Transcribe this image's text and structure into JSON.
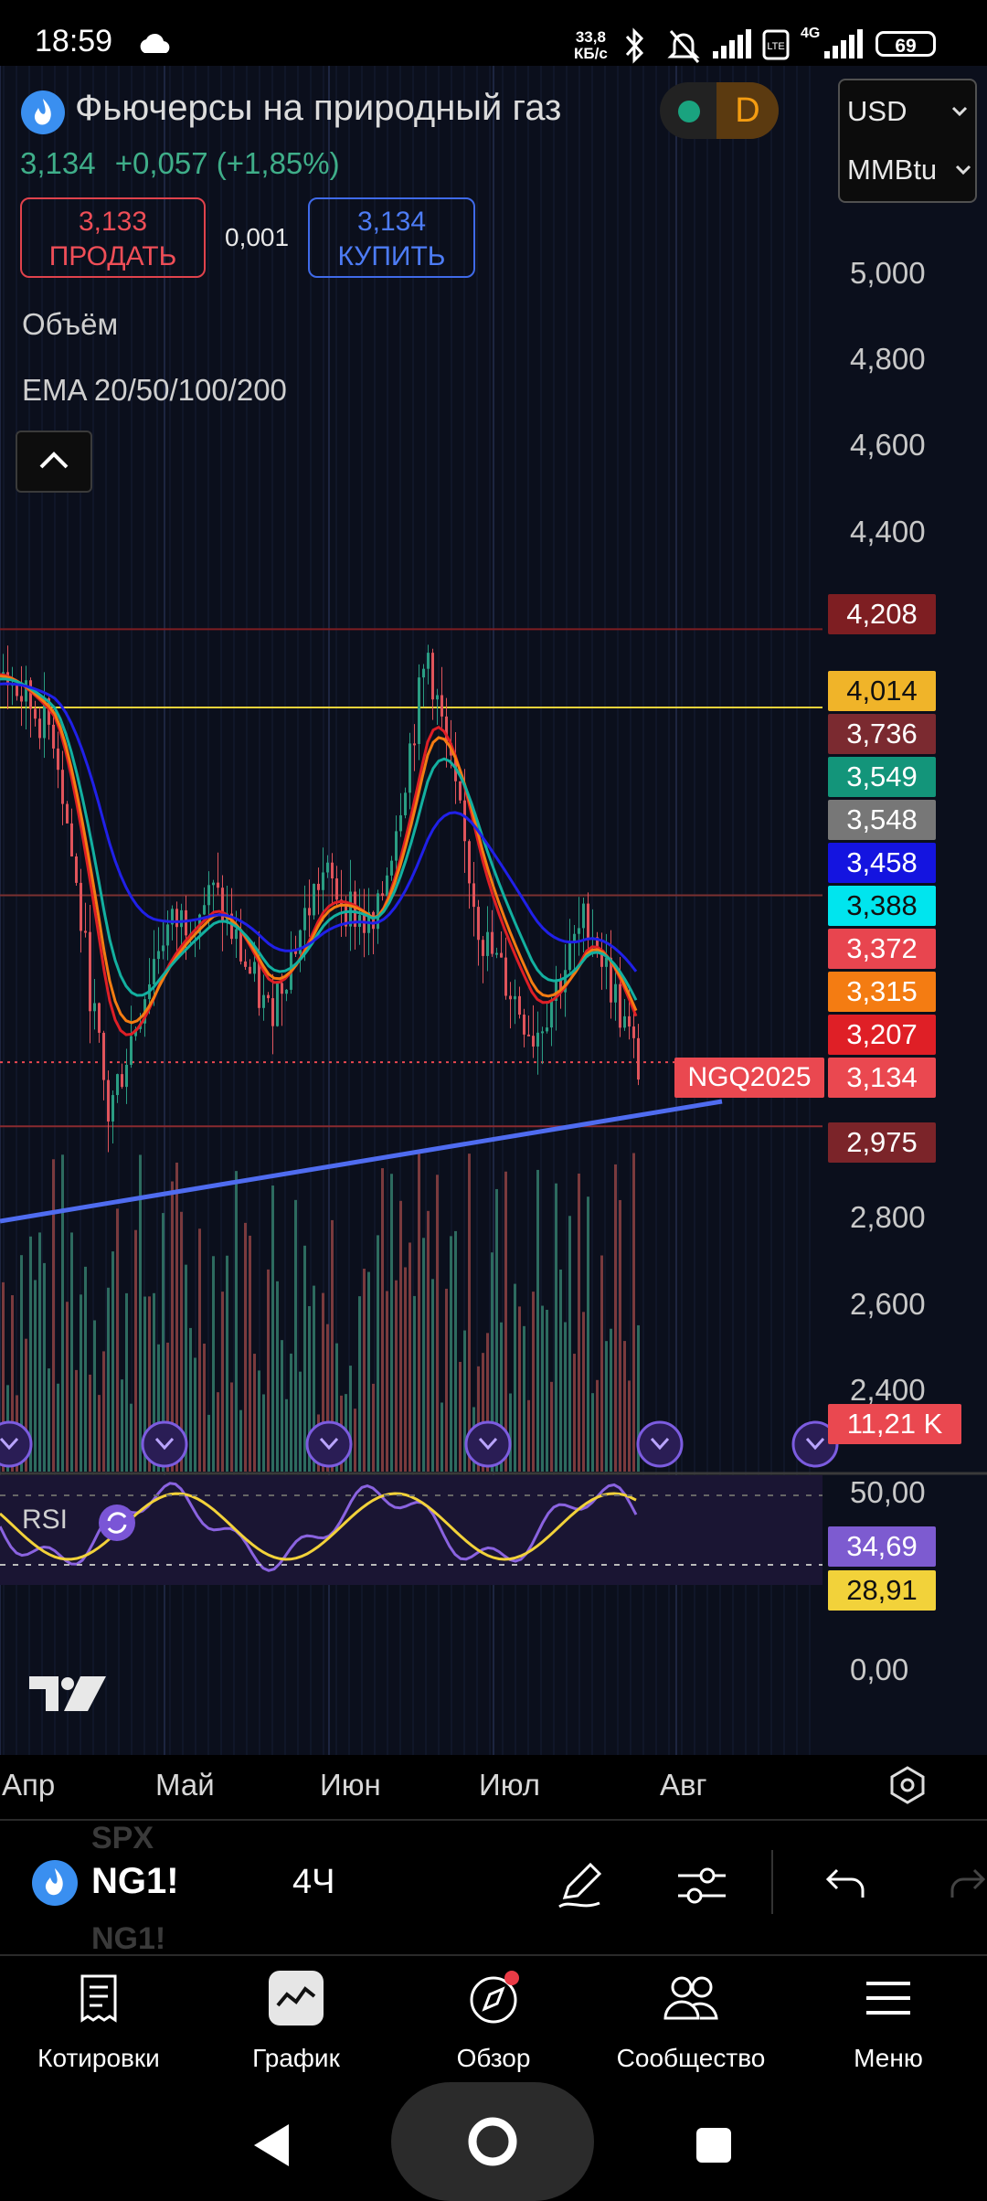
{
  "status_bar": {
    "time": "18:59",
    "net_speed_value": "33,8",
    "net_speed_unit": "КБ/с",
    "network": "4G",
    "battery": "69"
  },
  "header": {
    "title": "Фьючерсы на природный газ",
    "badge": "D",
    "last_price": "3,134",
    "change": "+0,057",
    "change_pct": "(+1,85%)",
    "currency": "USD",
    "unit": "MMBtu"
  },
  "trade": {
    "sell_price": "3,133",
    "sell_label": "ПРОДАТЬ",
    "spread": "0,001",
    "buy_price": "3,134",
    "buy_label": "КУПИТЬ"
  },
  "indicators": {
    "volume": "Объём",
    "ema": "EMA 20/50/100/200",
    "rsi": "RSI"
  },
  "price_axis": {
    "labels": [
      "5,000",
      "4,800",
      "4,600",
      "4,400",
      "2,800",
      "2,600",
      "2,400",
      "50,00",
      "0,00"
    ],
    "badges": [
      {
        "text": "4,208",
        "color": "#7e1e22"
      },
      {
        "text": "4,014",
        "color": "#f0b429"
      },
      {
        "text": "3,736",
        "color": "#7b2a30"
      },
      {
        "text": "3,549",
        "color": "#13957a"
      },
      {
        "text": "3,548",
        "color": "#777777"
      },
      {
        "text": "3,458",
        "color": "#1414e0"
      },
      {
        "text": "3,388",
        "color": "#00e5ee"
      },
      {
        "text": "3,372",
        "color": "#e8454f"
      },
      {
        "text": "3,315",
        "color": "#f47c12"
      },
      {
        "text": "3,207",
        "color": "#df1f26"
      },
      {
        "text": "3,134",
        "color": "#ea4850"
      },
      {
        "text": "2,975",
        "color": "#7b2429"
      },
      {
        "text": "11,21 K",
        "color": "#ea4850"
      },
      {
        "text": "34,69",
        "color": "#7d5bd0"
      },
      {
        "text": "28,91",
        "color": "#f2d23a"
      }
    ],
    "symbol_tag": "NGQ2025"
  },
  "time_axis": [
    "Апр",
    "Май",
    "Июн",
    "Июл",
    "Авг"
  ],
  "toolbar": {
    "symbol": "NG1!",
    "interval": "4Ч",
    "ghost_above": "SPX",
    "ghost_below": "NG1!"
  },
  "bottom_nav": [
    {
      "label": "Котировки",
      "icon": "quotes-icon"
    },
    {
      "label": "График",
      "icon": "chart-icon"
    },
    {
      "label": "Обзор",
      "icon": "compass-icon"
    },
    {
      "label": "Сообщество",
      "icon": "community-icon"
    },
    {
      "label": "Меню",
      "icon": "menu-icon"
    }
  ],
  "chart_data": {
    "type": "line",
    "title": "Фьючерсы на природный газ",
    "symbol": "NG1!",
    "interval": "4Ч",
    "x": [
      "Апр",
      "Май",
      "Июн",
      "Июл",
      "Авг"
    ],
    "ylim": [
      2.3,
      5.1
    ],
    "series": [
      {
        "name": "",
        "values": [
          4.1,
          3.95,
          3.0,
          3.45,
          3.55,
          3.25,
          3.6,
          3.45,
          4.15,
          3.45,
          3.2,
          3.5,
          3.1
        ]
      }
    ],
    "horizontal_levels": [
      4.208,
      4.014,
      3.548,
      2.975
    ],
    "last": 3.134,
    "volume_last": "11,21 K",
    "rsi": [
      34.69,
      28.91
    ]
  }
}
